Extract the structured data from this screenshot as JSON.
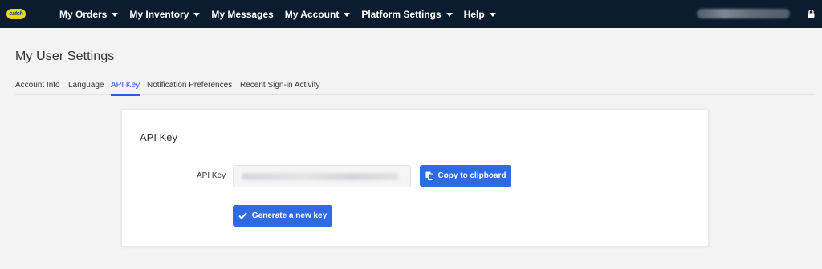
{
  "brand": {
    "logo_text": "catch",
    "logo_color": "#f2d21b"
  },
  "nav": {
    "items": [
      {
        "label": "My Orders",
        "has_dropdown": true
      },
      {
        "label": "My Inventory",
        "has_dropdown": true
      },
      {
        "label": "My Messages",
        "has_dropdown": false
      },
      {
        "label": "My Account",
        "has_dropdown": true
      },
      {
        "label": "Platform Settings",
        "has_dropdown": true
      },
      {
        "label": "Help",
        "has_dropdown": true
      }
    ],
    "background": "#0b1c31",
    "right_icon": "lock-icon"
  },
  "page": {
    "title": "My User Settings"
  },
  "tabs": {
    "items": [
      {
        "label": "Account Info",
        "active": false
      },
      {
        "label": "Language",
        "active": false
      },
      {
        "label": "API Key",
        "active": true
      },
      {
        "label": "Notification Preferences",
        "active": false
      },
      {
        "label": "Recent Sign-in Activity",
        "active": false
      }
    ],
    "accent": "#2b5fd9"
  },
  "card": {
    "title": "API Key",
    "field_label": "API Key",
    "copy_button": {
      "label": "Copy to clipboard",
      "icon": "copy-icon"
    },
    "generate_button": {
      "label": "Generate a new key",
      "icon": "checkmark-icon"
    },
    "button_color": "#2f6ae5"
  }
}
